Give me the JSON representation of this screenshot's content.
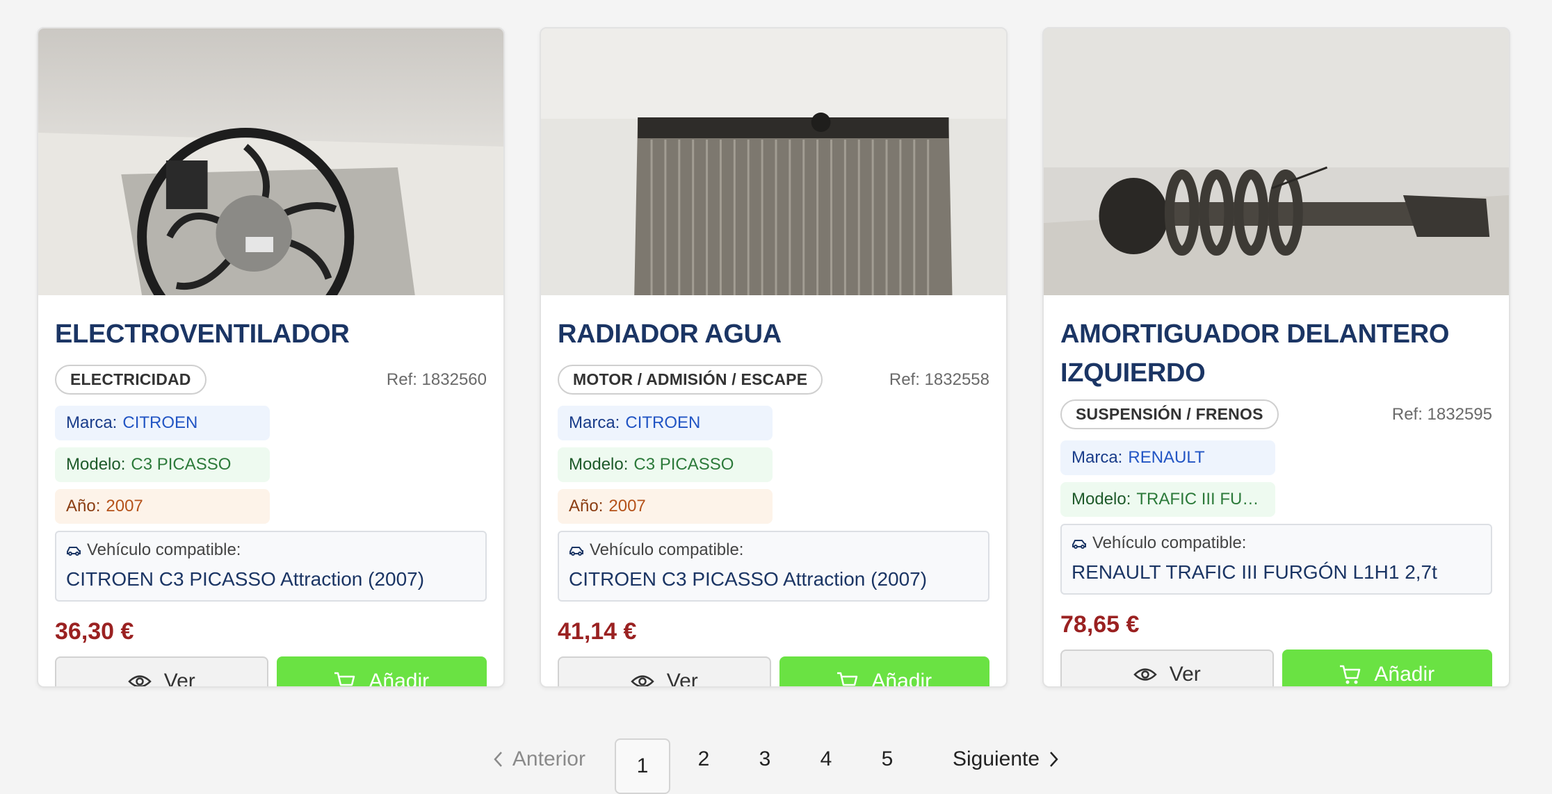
{
  "products": [
    {
      "title": "ELECTROVENTILADOR",
      "category": "ELECTRICIDAD",
      "ref": "Ref: 1832560",
      "brand_label": "Marca:",
      "brand": "CITROEN",
      "model_label": "Modelo:",
      "model": "C3 PICASSO",
      "year_label": "Año:",
      "year": "2007",
      "compat_label": "Vehículo compatible:",
      "compat_value": "CITROEN C3 PICASSO Attraction (2007)",
      "price": "36,30 €",
      "view_label": "Ver",
      "add_label": "Añadir"
    },
    {
      "title": "RADIADOR AGUA",
      "category": "MOTOR / ADMISIÓN / ESCAPE",
      "ref": "Ref: 1832558",
      "brand_label": "Marca:",
      "brand": "CITROEN",
      "model_label": "Modelo:",
      "model": "C3 PICASSO",
      "year_label": "Año:",
      "year": "2007",
      "compat_label": "Vehículo compatible:",
      "compat_value": "CITROEN C3 PICASSO Attraction (2007)",
      "price": "41,14 €",
      "view_label": "Ver",
      "add_label": "Añadir"
    },
    {
      "title": "AMORTIGUADOR DELANTERO IZQUIERDO",
      "category": "SUSPENSIÓN / FRENOS",
      "ref": "Ref: 1832595",
      "brand_label": "Marca:",
      "brand": "RENAULT",
      "model_label": "Modelo:",
      "model": "TRAFIC III FUR...",
      "compat_label": "Vehículo compatible:",
      "compat_value": "RENAULT TRAFIC III FURGÓN L1H1 2,7t",
      "price": "78,65 €",
      "view_label": "Ver",
      "add_label": "Añadir"
    }
  ],
  "pagination": {
    "prev_label": "Anterior",
    "next_label": "Siguiente",
    "pages": [
      "1",
      "2",
      "3",
      "4",
      "5"
    ],
    "current": "1"
  },
  "colors": {
    "title": "#1b3564",
    "price": "#9a2121",
    "add_button": "#6ae243"
  },
  "icons": {
    "view": "eye-icon",
    "add": "cart-icon",
    "vehicle": "car-icon",
    "prev": "chevron-left-icon",
    "next": "chevron-right-icon"
  }
}
